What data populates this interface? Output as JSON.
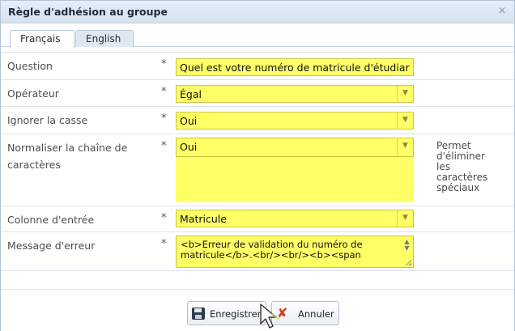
{
  "dialog": {
    "title": "Règle d'adhésion au groupe",
    "close_glyph": "×"
  },
  "tabs": [
    {
      "label": "Français",
      "active": true
    },
    {
      "label": "English",
      "active": false
    }
  ],
  "form": {
    "required_marker": "*",
    "rows": [
      {
        "label": "Question",
        "value": "Quel est votre numéro de matricule d'étudiar",
        "kind": "text"
      },
      {
        "label": "Opérateur",
        "value": "Égal",
        "kind": "dropdown"
      },
      {
        "label": "Ignorer la casse",
        "value": "Oui",
        "kind": "dropdown"
      },
      {
        "label": "Normaliser la chaîne de caractères",
        "value": "Oui",
        "kind": "dropdown",
        "hint": "Permet d'éliminer les caractères spéciaux"
      },
      {
        "label": "Colonne d'entrée",
        "value": "Matricule",
        "kind": "dropdown"
      },
      {
        "label": "Message d'erreur",
        "value": "<b>Erreur de validation du numéro de matricule</b>.<br/><br/><b><span",
        "kind": "textarea"
      }
    ]
  },
  "buttons": {
    "save": "Enregistrer",
    "cancel": "Annuler"
  },
  "icons": {
    "close": "close-icon",
    "save": "floppy-disk-icon",
    "cancel": "cancel-x-icon",
    "dropdown": "chevron-down-icon"
  },
  "colors": {
    "field_highlight": "#ffff66",
    "title_bar": "#dce6f1"
  }
}
